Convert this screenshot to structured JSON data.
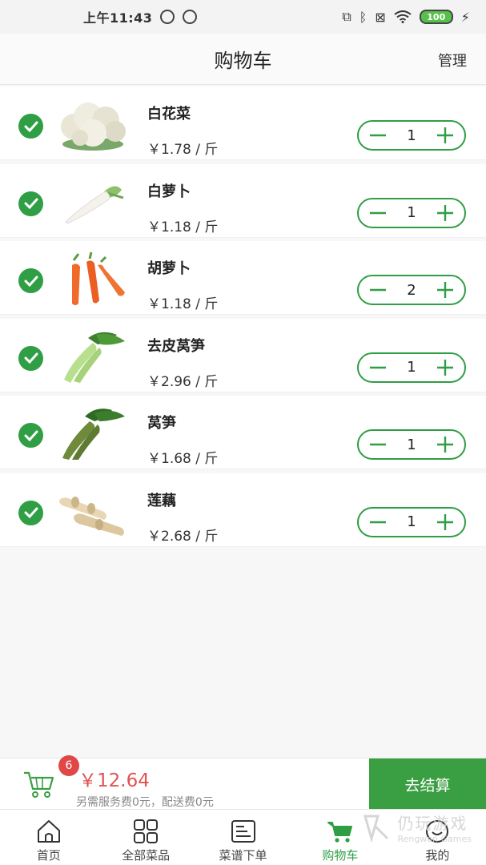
{
  "status_bar": {
    "time": "上午11:43",
    "battery": "100"
  },
  "header": {
    "title": "购物车",
    "manage": "管理"
  },
  "cart_items": [
    {
      "name": "白花菜",
      "price": "￥1.78 / 斤",
      "qty": "1",
      "veg": "cauliflower"
    },
    {
      "name": "白萝卜",
      "price": "￥1.18 / 斤",
      "qty": "1",
      "veg": "white-radish"
    },
    {
      "name": "胡萝卜",
      "price": "￥1.18 / 斤",
      "qty": "2",
      "veg": "carrot"
    },
    {
      "name": "去皮莴笋",
      "price": "￥2.96 / 斤",
      "qty": "1",
      "veg": "peeled-lettuce-stem"
    },
    {
      "name": "莴笋",
      "price": "￥1.68 / 斤",
      "qty": "1",
      "veg": "lettuce-stem"
    },
    {
      "name": "莲藕",
      "price": "￥2.68 / 斤",
      "qty": "1",
      "veg": "lotus-root"
    }
  ],
  "footer": {
    "badge": "6",
    "total": "￥12.64",
    "fee_note": "另需服务费0元，配送费0元",
    "checkout": "去结算"
  },
  "tabs": [
    {
      "label": "首页",
      "icon": "home-icon"
    },
    {
      "label": "全部菜品",
      "icon": "grid-icon"
    },
    {
      "label": "菜谱下单",
      "icon": "recipe-icon"
    },
    {
      "label": "购物车",
      "icon": "cart-icon",
      "active": true
    },
    {
      "label": "我的",
      "icon": "profile-icon"
    }
  ],
  "watermark": {
    "cn": "仍玩游戏",
    "en": "Rengwan Games"
  },
  "colors": {
    "accent": "#2f9e44",
    "price_red": "#e25353",
    "badge_red": "#e04848"
  }
}
